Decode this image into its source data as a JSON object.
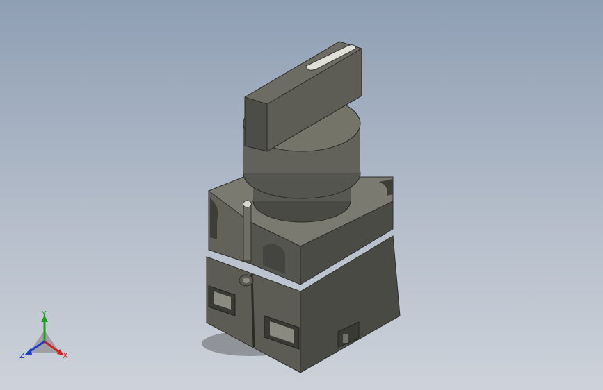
{
  "viewport": {
    "background_top": "#8f9fb4",
    "background_bottom": "#cdd2da",
    "model": {
      "body_color": "#5a5a54",
      "shade_color": "#3f3f3a",
      "light_color": "#707068"
    }
  },
  "triad": {
    "x_label": "X",
    "y_label": "Y",
    "z_label": "Z",
    "x_color": "#d22020",
    "y_color": "#1ea01e",
    "z_color": "#1e3ccd"
  }
}
